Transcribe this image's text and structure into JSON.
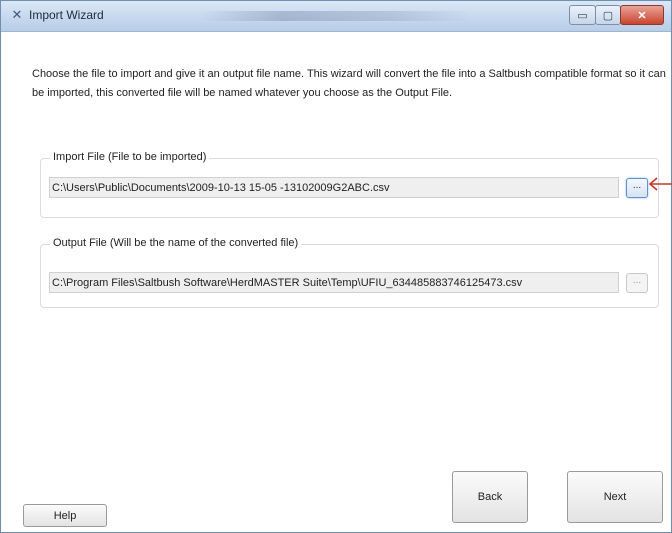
{
  "window": {
    "title": "Import Wizard",
    "controls": {
      "minimize": "▭",
      "maximize": "▢",
      "close": "✕"
    }
  },
  "description": "Choose the file to import and give it an output file name. This wizard will convert the file into a Saltbush compatible format so it can be imported, this converted file will be named whatever you choose as the Output File.",
  "import_group": {
    "label": "Import File (File to be imported)",
    "path": "C:\\Users\\Public\\Documents\\2009-10-13 15-05 -13102009G2ABC.csv",
    "browse_label": "...",
    "browse_enabled": true
  },
  "output_group": {
    "label": "Output File (Will be the name of the converted file)",
    "path": "C:\\Program Files\\Saltbush Software\\HerdMASTER Suite\\Temp\\UFIU_634485883746125473.csv",
    "browse_label": "...",
    "browse_enabled": false
  },
  "buttons": {
    "back": "Back",
    "next": "Next",
    "help": "Help"
  },
  "colors": {
    "callout_arrow": "#c0392b",
    "titlebar": "#c6d8ee",
    "close_button": "#c8452f"
  },
  "icons": {
    "app_icon": "wizard-icon",
    "callout": "arrow-left-icon"
  }
}
